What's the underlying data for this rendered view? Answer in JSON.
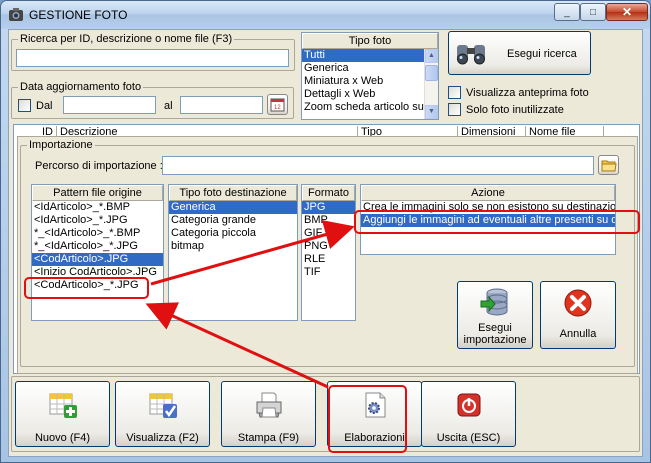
{
  "window": {
    "title": "GESTIONE FOTO",
    "min_glyph": "_",
    "max_glyph": "□",
    "close_glyph": "✕"
  },
  "search": {
    "label": "Ricerca per ID, descrizione o nome file (F3)",
    "value": "",
    "date_label": "Data aggiornamento foto",
    "dal_label": "Dal",
    "al_label": "al",
    "dal_value": "",
    "al_value": "",
    "calendar_text": "12"
  },
  "tipo_foto": {
    "header": "Tipo foto",
    "items": [
      "Tutti",
      "Generica",
      "Miniatura x Web",
      "Dettagli x Web",
      "Zoom scheda articolo su"
    ],
    "selected": 0
  },
  "esegui_ricerca": "Esegui ricerca",
  "options": {
    "anteprima": "Visualizza anteprima foto",
    "inutilizzate": "Solo foto inutilizzate"
  },
  "grid": {
    "columns": [
      "ID",
      "Descrizione",
      "Tipo",
      "Dimensioni",
      "Nome file"
    ]
  },
  "import": {
    "group_label": "Importazione",
    "path_label": "Percorso di importazione :",
    "path_value": "",
    "pattern": {
      "header": "Pattern file origine",
      "items": [
        "<IdArticolo>_*.BMP",
        "<IdArticolo>_*.JPG",
        "*_<IdArticolo>_*.BMP",
        "*_<IdArticolo>_*.JPG",
        "<CodArticolo>.JPG",
        "<Inizio CodArticolo>.JPG",
        "<CodArticolo>_*.JPG"
      ],
      "selected": 4
    },
    "tipo_dest": {
      "header": "Tipo foto destinazione",
      "items": [
        "Generica",
        "Categoria grande",
        "Categoria piccola",
        "bitmap"
      ],
      "selected": 0
    },
    "formato": {
      "header": "Formato",
      "items": [
        "JPG",
        "BMP",
        "GIF",
        "PNG",
        "RLE",
        "TIF"
      ],
      "selected": 0
    },
    "azione": {
      "header": "Azione",
      "items": [
        "Crea le immagini solo se non esistono su destinazione",
        "Aggiungi le immagini ad eventuali altre presenti su destinazione"
      ],
      "selected": 1
    },
    "esegui_importazione": "Esegui\nimportazione",
    "annulla": "Annulla"
  },
  "toolbar": {
    "nuovo": "Nuovo (F4)",
    "visualizza": "Visualizza (F2)",
    "stampa": "Stampa (F9)",
    "elaborazioni": "Elaborazioni",
    "uscita": "Uscita (ESC)"
  },
  "colors": {
    "selection": "#316ac5",
    "highlight": "#e01010"
  }
}
